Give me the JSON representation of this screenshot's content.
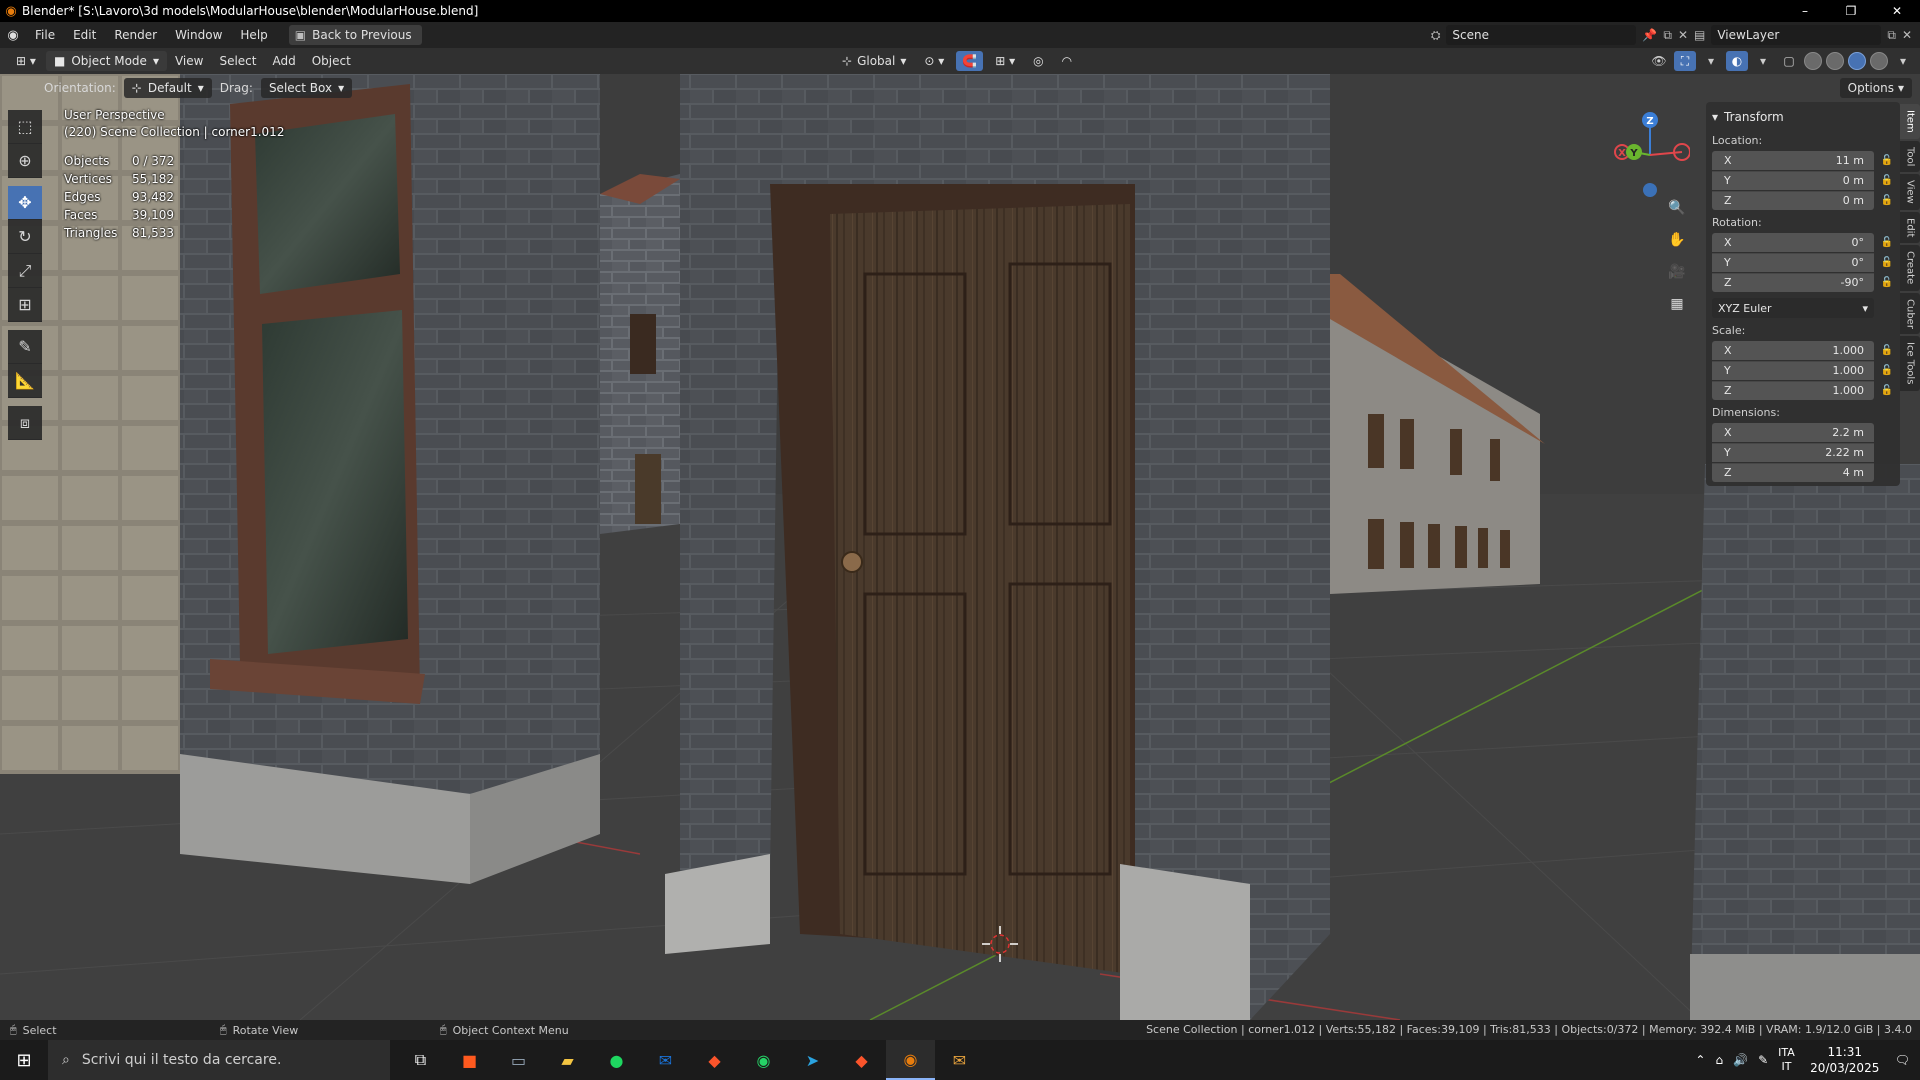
{
  "window": {
    "title": "Blender* [S:\\Lavoro\\3d models\\ModularHouse\\blender\\ModularHouse.blend]",
    "controls": [
      "–",
      "❐",
      "✕"
    ]
  },
  "menubar": {
    "items": [
      "File",
      "Edit",
      "Render",
      "Window",
      "Help"
    ],
    "back_button": "Back to Previous",
    "scene": "Scene",
    "view_layer": "ViewLayer"
  },
  "header": {
    "mode": "Object Mode",
    "menus": [
      "View",
      "Select",
      "Add",
      "Object"
    ],
    "transform_orientation": "Global"
  },
  "tool_settings": {
    "orientation_label": "Orientation:",
    "orientation_value": "Default",
    "drag_label": "Drag:",
    "drag_value": "Select Box",
    "options_label": "Options"
  },
  "overlay": {
    "perspective": "User Perspective",
    "collection": "(220) Scene Collection | corner1.012",
    "stats": [
      {
        "label": "Objects",
        "value": "0 / 372"
      },
      {
        "label": "Vertices",
        "value": "55,182"
      },
      {
        "label": "Edges",
        "value": "93,482"
      },
      {
        "label": "Faces",
        "value": "39,109"
      },
      {
        "label": "Triangles",
        "value": "81,533"
      }
    ]
  },
  "gizmo": {
    "x": "X",
    "y": "Y",
    "z": "Z"
  },
  "npanel": {
    "panel_title": "Transform",
    "location_label": "Location:",
    "location": [
      {
        "axis": "X",
        "value": "11 m"
      },
      {
        "axis": "Y",
        "value": "0 m"
      },
      {
        "axis": "Z",
        "value": "0 m"
      }
    ],
    "rotation_label": "Rotation:",
    "rotation": [
      {
        "axis": "X",
        "value": "0°"
      },
      {
        "axis": "Y",
        "value": "0°"
      },
      {
        "axis": "Z",
        "value": "-90°"
      }
    ],
    "rotation_mode": "XYZ Euler",
    "scale_label": "Scale:",
    "scale": [
      {
        "axis": "X",
        "value": "1.000"
      },
      {
        "axis": "Y",
        "value": "1.000"
      },
      {
        "axis": "Z",
        "value": "1.000"
      }
    ],
    "dimensions_label": "Dimensions:",
    "dimensions": [
      {
        "axis": "X",
        "value": "2.2 m"
      },
      {
        "axis": "Y",
        "value": "2.22 m"
      },
      {
        "axis": "Z",
        "value": "4 m"
      }
    ]
  },
  "sidetabs": [
    "Item",
    "Tool",
    "View",
    "Edit",
    "Create",
    "Cuber",
    "Ice Tools"
  ],
  "statusbar": {
    "hint_select": "Select",
    "hint_rotate": "Rotate View",
    "hint_context": "Object Context Menu",
    "info": "Scene Collection | corner1.012 | Verts:55,182 | Faces:39,109 | Tris:81,533 | Objects:0/372 | Memory: 392.4 MiB | VRAM: 1.9/12.0 GiB | 3.4.0"
  },
  "taskbar": {
    "search_placeholder": "Scrivi qui il testo da cercare.",
    "lang_top": "ITA",
    "lang_bottom": "IT",
    "time": "11:31",
    "date": "20/03/2025"
  },
  "colors": {
    "accent": "#4772b3",
    "axis_x": "#e0464b",
    "axis_y": "#6ab52e",
    "axis_z": "#3b7ed6"
  }
}
